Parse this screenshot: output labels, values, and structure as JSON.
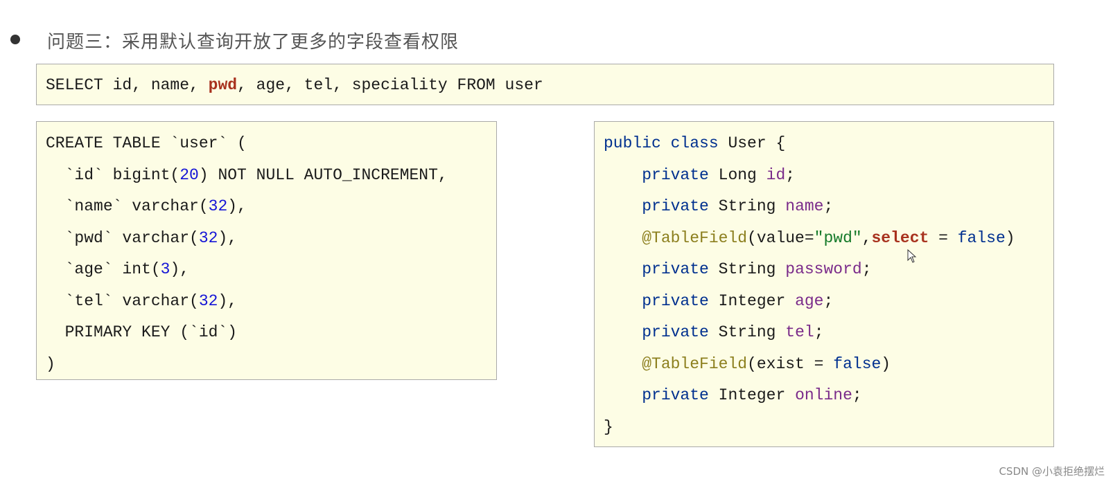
{
  "heading": "问题三：采用默认查询开放了更多的字段查看权限",
  "select_box": [
    [
      {
        "t": "SELECT id, name, ",
        "c": ""
      },
      {
        "t": "pwd",
        "c": "hl"
      },
      {
        "t": ", age, tel, speciality FROM user",
        "c": ""
      }
    ]
  ],
  "ddl_box": [
    [
      {
        "t": "CREATE TABLE `user` (",
        "c": ""
      }
    ],
    [
      {
        "t": "  `id` bigint(",
        "c": ""
      },
      {
        "t": "20",
        "c": "num"
      },
      {
        "t": ") NOT NULL AUTO_INCREMENT,",
        "c": ""
      }
    ],
    [
      {
        "t": "  `name` varchar(",
        "c": ""
      },
      {
        "t": "32",
        "c": "num"
      },
      {
        "t": "),",
        "c": ""
      }
    ],
    [
      {
        "t": "  `pwd` varchar(",
        "c": ""
      },
      {
        "t": "32",
        "c": "num"
      },
      {
        "t": "),",
        "c": ""
      }
    ],
    [
      {
        "t": "  `age` int(",
        "c": ""
      },
      {
        "t": "3",
        "c": "num"
      },
      {
        "t": "),",
        "c": ""
      }
    ],
    [
      {
        "t": "  `tel` varchar(",
        "c": ""
      },
      {
        "t": "32",
        "c": "num"
      },
      {
        "t": "),",
        "c": ""
      }
    ],
    [
      {
        "t": "  PRIMARY KEY (`id`)",
        "c": ""
      }
    ],
    [
      {
        "t": ")",
        "c": ""
      }
    ]
  ],
  "class_box": [
    [
      {
        "t": "public class",
        "c": "kw"
      },
      {
        "t": " User {",
        "c": ""
      }
    ],
    [
      {
        "t": "    ",
        "c": ""
      },
      {
        "t": "private",
        "c": "kw"
      },
      {
        "t": " Long ",
        "c": ""
      },
      {
        "t": "id",
        "c": "fld"
      },
      {
        "t": ";",
        "c": ""
      }
    ],
    [
      {
        "t": "    ",
        "c": ""
      },
      {
        "t": "private",
        "c": "kw"
      },
      {
        "t": " String ",
        "c": ""
      },
      {
        "t": "name",
        "c": "fld"
      },
      {
        "t": ";",
        "c": ""
      }
    ],
    [
      {
        "t": "    ",
        "c": ""
      },
      {
        "t": "@TableField",
        "c": "ann"
      },
      {
        "t": "(value=",
        "c": ""
      },
      {
        "t": "\"pwd\"",
        "c": "str"
      },
      {
        "t": ",",
        "c": ""
      },
      {
        "t": "select",
        "c": "hl"
      },
      {
        "t": " = ",
        "c": ""
      },
      {
        "t": "false",
        "c": "kw"
      },
      {
        "t": ")",
        "c": ""
      }
    ],
    [
      {
        "t": "    ",
        "c": ""
      },
      {
        "t": "private",
        "c": "kw"
      },
      {
        "t": " String ",
        "c": ""
      },
      {
        "t": "password",
        "c": "fld"
      },
      {
        "t": ";",
        "c": ""
      }
    ],
    [
      {
        "t": "    ",
        "c": ""
      },
      {
        "t": "private",
        "c": "kw"
      },
      {
        "t": " Integer ",
        "c": ""
      },
      {
        "t": "age",
        "c": "fld"
      },
      {
        "t": ";",
        "c": ""
      }
    ],
    [
      {
        "t": "    ",
        "c": ""
      },
      {
        "t": "private",
        "c": "kw"
      },
      {
        "t": " String ",
        "c": ""
      },
      {
        "t": "tel",
        "c": "fld"
      },
      {
        "t": ";",
        "c": ""
      }
    ],
    [
      {
        "t": "    ",
        "c": ""
      },
      {
        "t": "@TableField",
        "c": "ann"
      },
      {
        "t": "(exist = ",
        "c": ""
      },
      {
        "t": "false",
        "c": "kw"
      },
      {
        "t": ")",
        "c": ""
      }
    ],
    [
      {
        "t": "    ",
        "c": ""
      },
      {
        "t": "private",
        "c": "kw"
      },
      {
        "t": " Integer ",
        "c": ""
      },
      {
        "t": "online",
        "c": "fld"
      },
      {
        "t": ";",
        "c": ""
      }
    ],
    [
      {
        "t": "}",
        "c": ""
      }
    ]
  ],
  "watermark": "CSDN @小袁拒绝摆烂"
}
